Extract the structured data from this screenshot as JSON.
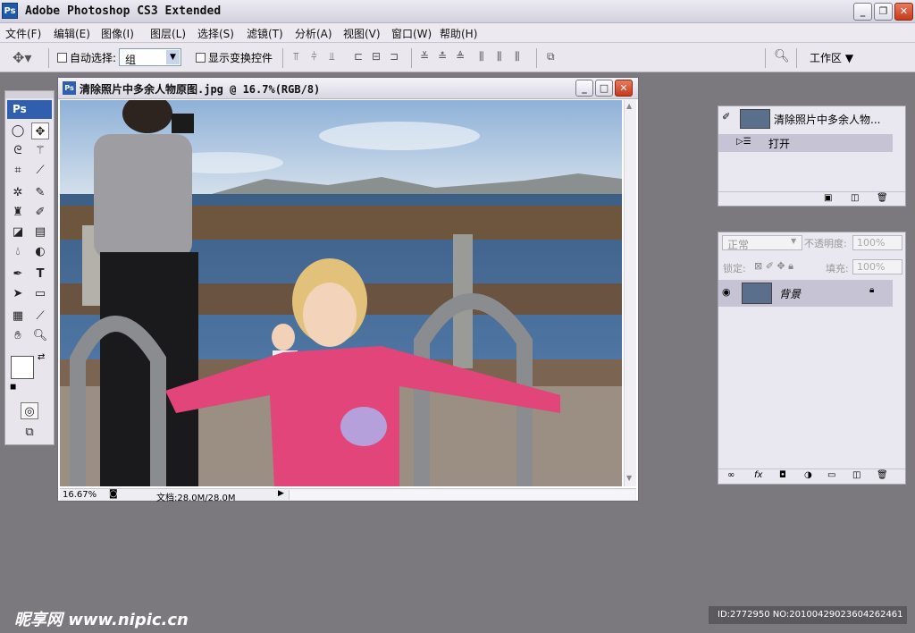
{
  "app": {
    "title": "Adobe Photoshop CS3 Extended",
    "logo": "Ps"
  },
  "menu": [
    "文件(F)",
    "编辑(E)",
    "图像(I)",
    "图层(L)",
    "选择(S)",
    "滤镜(T)",
    "分析(A)",
    "视图(V)",
    "窗口(W)",
    "帮助(H)"
  ],
  "options": {
    "auto_select_label": "自动选择:",
    "auto_select_value": "组",
    "show_transform_label": "显示变换控件",
    "workspace_label": "工作区 ▼"
  },
  "toolbox": {
    "logo": "Ps"
  },
  "document": {
    "title": "清除照片中多余人物原图.jpg @ 16.7%(RGB/8)",
    "zoom": "16.67%",
    "doc_size": "文档:28.0M/28.0M"
  },
  "history": {
    "snapshot_label": "清除照片中多余人物...",
    "items": [
      "打开"
    ]
  },
  "layers": {
    "blend_mode": "正常",
    "opacity_label": "不透明度:",
    "opacity_value": "100%",
    "lock_label": "锁定:",
    "fill_label": "填充:",
    "fill_value": "100%",
    "items": [
      {
        "name": "背景"
      }
    ]
  },
  "watermark": {
    "text": "昵享网 www.nipic.cn",
    "id": "ID:2772950 NO:20100429023604262461"
  },
  "colors": {
    "background": "#7b797e",
    "accent": "#2f5fae",
    "close": "#c53a1b"
  }
}
